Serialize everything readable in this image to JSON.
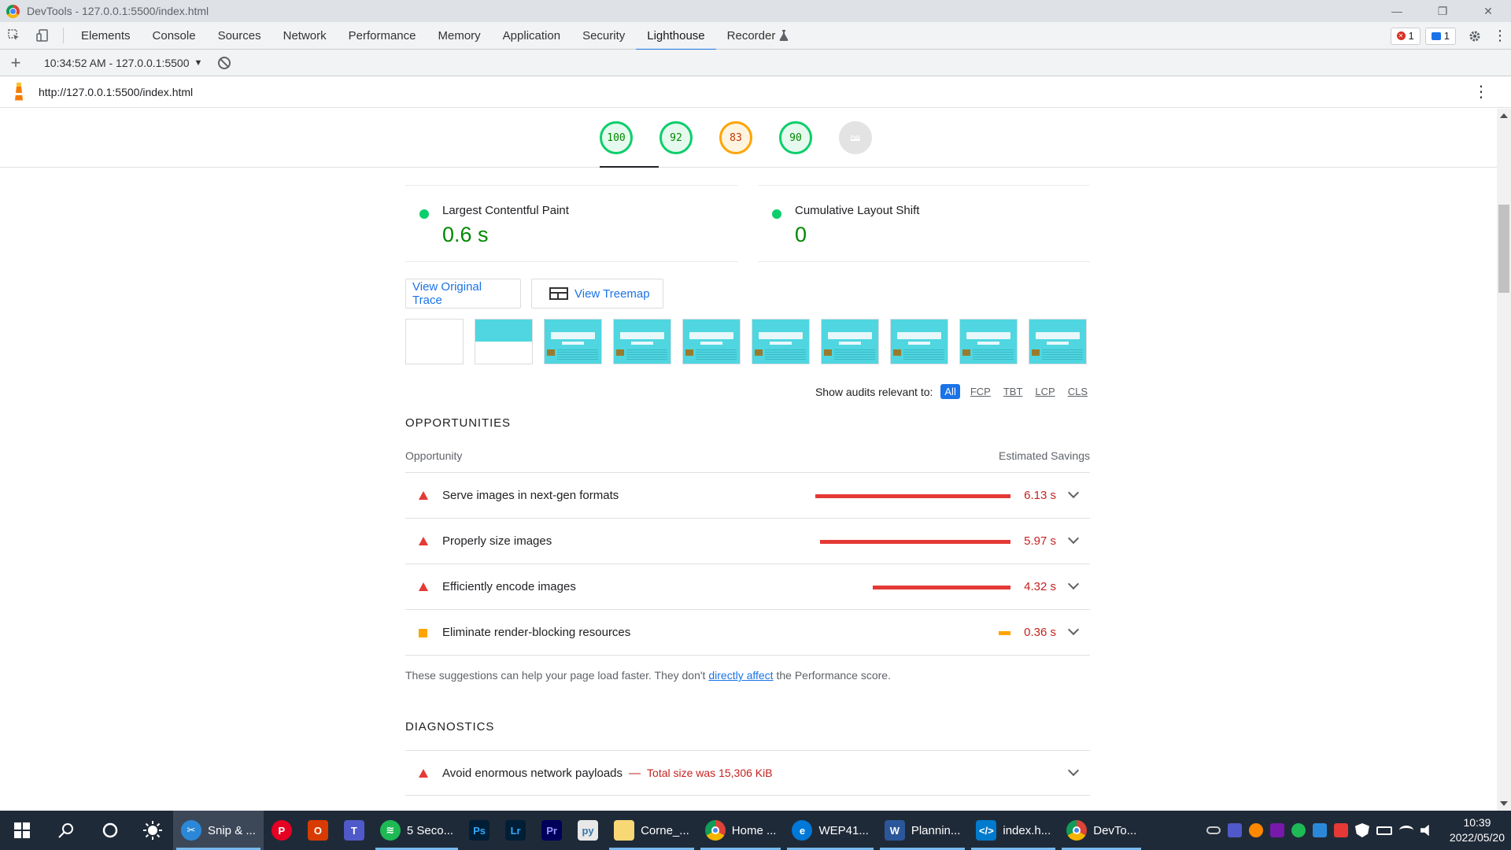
{
  "window": {
    "title": "DevTools - 127.0.0.1:5500/index.html",
    "controls": [
      "—",
      "❐",
      "✕"
    ]
  },
  "devtools": {
    "tabs": [
      "Elements",
      "Console",
      "Sources",
      "Network",
      "Performance",
      "Memory",
      "Application",
      "Security",
      "Lighthouse",
      "Recorder"
    ],
    "active_tab": "Lighthouse",
    "recorder_icon": "flask-icon",
    "error_count": "1",
    "message_count": "1"
  },
  "reportbar": {
    "plus": "+",
    "selected_report": "10:34:52 AM - 127.0.0.1:5500",
    "dropdown_glyph": "▼"
  },
  "urlbar": {
    "url": "http://127.0.0.1:5500/index.html",
    "menu_glyph": "⋮"
  },
  "gauges": [
    {
      "score": "100",
      "status": "pass"
    },
    {
      "score": "92",
      "status": "pass"
    },
    {
      "score": "83",
      "status": "average"
    },
    {
      "score": "90",
      "status": "pass"
    },
    {
      "score": "PWA",
      "status": "pwa"
    }
  ],
  "metrics": {
    "lcp_label": "Largest Contentful Paint",
    "lcp_value": "0.6 s",
    "cls_label": "Cumulative Layout Shift",
    "cls_value": "0"
  },
  "buttons": {
    "trace": "View Original Trace",
    "treemap": "View Treemap"
  },
  "relevant": {
    "label": "Show audits relevant to:",
    "chips": [
      "All",
      "FCP",
      "TBT",
      "LCP",
      "CLS"
    ],
    "active": "All"
  },
  "opportunities": {
    "heading": "OPPORTUNITIES",
    "col_left": "Opportunity",
    "col_right": "Estimated Savings",
    "items": [
      {
        "title": "Serve images in next-gen formats",
        "saving": "6.13 s",
        "bar_fraction": 1.0,
        "status": "fail"
      },
      {
        "title": "Properly size images",
        "saving": "5.97 s",
        "bar_fraction": 0.974,
        "status": "fail"
      },
      {
        "title": "Efficiently encode images",
        "saving": "4.32 s",
        "bar_fraction": 0.705,
        "status": "fail"
      },
      {
        "title": "Eliminate render-blocking resources",
        "saving": "0.36 s",
        "bar_fraction": 0.059,
        "status": "average"
      }
    ],
    "footnote_pre": "These suggestions can help your page load faster. They don't ",
    "footnote_link": "directly affect",
    "footnote_post": " the Performance score."
  },
  "diagnostics": {
    "heading": "DIAGNOSTICS",
    "items": [
      {
        "title": "Avoid enormous network payloads",
        "display": "Total size was 15,306 KiB"
      }
    ]
  },
  "taskbar": {
    "items": [
      {
        "label": "Snip & ...",
        "icon": "snip-icon",
        "color": "#2b88d8"
      },
      {
        "label": "",
        "icon": "pinterest-icon",
        "color": "#e60023"
      },
      {
        "label": "",
        "icon": "office-icon",
        "color": "#d83b01"
      },
      {
        "label": "",
        "icon": "teams-icon",
        "color": "#5059c9"
      },
      {
        "label": "5 Seco...",
        "icon": "spotify-icon",
        "color": "#1db954"
      },
      {
        "label": "",
        "icon": "photoshop-icon",
        "color": "#001e36"
      },
      {
        "label": "",
        "icon": "lightroom-icon",
        "color": "#001e36"
      },
      {
        "label": "",
        "icon": "premiere-icon",
        "color": "#00005b"
      },
      {
        "label": "",
        "icon": "python-file-icon",
        "color": "#3776ab"
      },
      {
        "label": "Corne_...",
        "icon": "folder-icon",
        "color": "#f8d775"
      },
      {
        "label": "Home ...",
        "icon": "chrome-icon",
        "color": "#4285f4"
      },
      {
        "label": "WEP41...",
        "icon": "edge-icon",
        "color": "#0078d7"
      },
      {
        "label": "Plannin...",
        "icon": "word-icon",
        "color": "#2b579a"
      },
      {
        "label": "index.h...",
        "icon": "vscode-icon",
        "color": "#007acc"
      },
      {
        "label": "DevTo...",
        "icon": "chrome-icon",
        "color": "#4285f4"
      }
    ],
    "time": "10:39",
    "date": "2022/05/20"
  }
}
